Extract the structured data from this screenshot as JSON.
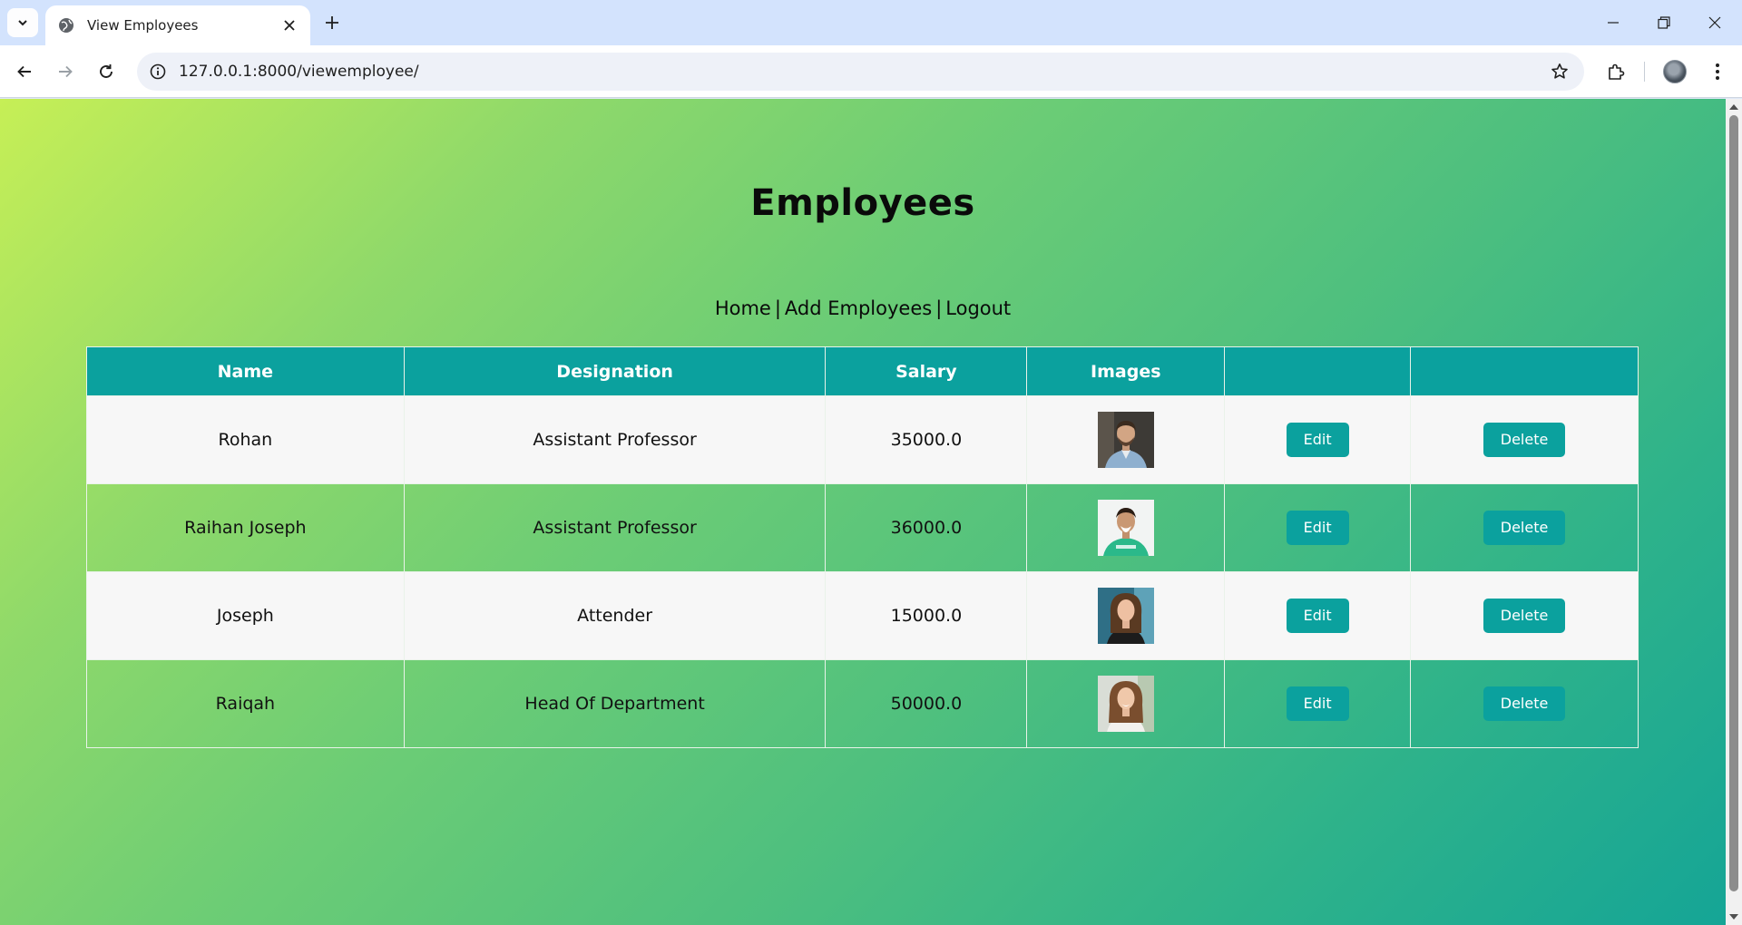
{
  "browser": {
    "tab_title": "View Employees",
    "url": "127.0.0.1:8000/viewemployee/"
  },
  "page": {
    "title": "Employees",
    "nav": {
      "home": "Home",
      "add": "Add Employees",
      "logout": "Logout",
      "separator": "|"
    }
  },
  "table": {
    "headers": [
      "Name",
      "Designation",
      "Salary",
      "Images",
      "",
      ""
    ],
    "edit_label": "Edit",
    "delete_label": "Delete",
    "rows": [
      {
        "name": "Rohan",
        "designation": "Assistant Professor",
        "salary": "35000.0"
      },
      {
        "name": "Raihan Joseph",
        "designation": "Assistant Professor",
        "salary": "36000.0"
      },
      {
        "name": "Joseph",
        "designation": "Attender",
        "salary": "15000.0"
      },
      {
        "name": "Raiqah",
        "designation": "Head Of Department",
        "salary": "50000.0"
      }
    ]
  },
  "colors": {
    "accent": "#0ba19e",
    "gradient_start": "#c6ef56",
    "gradient_end": "#15a596",
    "row_light": "#f7f7f7"
  }
}
